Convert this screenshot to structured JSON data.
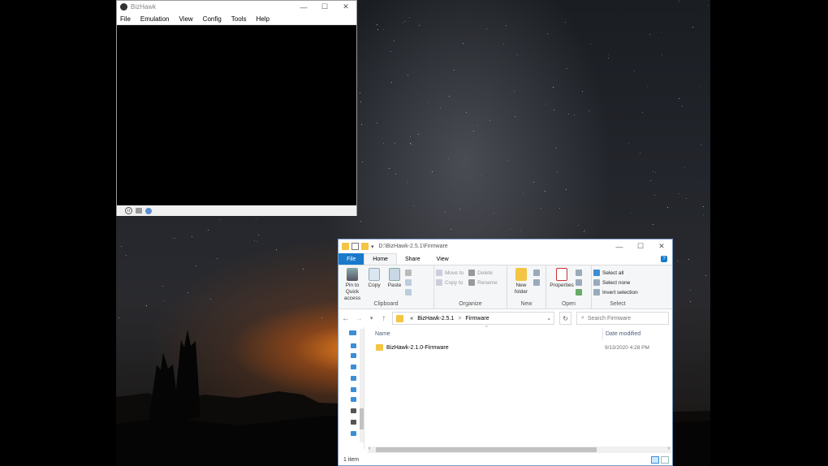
{
  "bizhawk": {
    "title": "BizHawk",
    "menu": [
      "File",
      "Emulation",
      "View",
      "Config",
      "Tools",
      "Help"
    ],
    "caption": {
      "minimize": "—",
      "maximize": "☐",
      "close": "✕"
    }
  },
  "explorer": {
    "title_path": "D:\\BizHawk-2.5.1\\Firmware",
    "caption": {
      "minimize": "—",
      "maximize": "☐",
      "close": "✕"
    },
    "tabs": {
      "file": "File",
      "home": "Home",
      "share": "Share",
      "view": "View"
    },
    "ribbon": {
      "clipboard": {
        "pin": "Pin to Quick access",
        "copy": "Copy",
        "paste": "Paste",
        "label": "Clipboard"
      },
      "organize": {
        "move_to": "Move to",
        "copy_to": "Copy to",
        "delete": "Delete",
        "rename": "Rename",
        "label": "Organize"
      },
      "new": {
        "new_folder": "New folder",
        "label": "New"
      },
      "open": {
        "properties": "Properties",
        "label": "Open"
      },
      "select": {
        "select_all": "Select all",
        "select_none": "Select none",
        "invert": "Invert selection",
        "label": "Select"
      }
    },
    "address": {
      "root_glyph": "«",
      "crumbs": [
        "BizHawk-2.5.1",
        "Firmware"
      ],
      "separator": ">"
    },
    "search_placeholder": "Search Firmware",
    "columns": {
      "name": "Name",
      "date_modified": "Date modified"
    },
    "files": [
      {
        "name": "BizHawk-2.1.0-Firmware",
        "date": "9/13/2020 4:28 PM"
      }
    ],
    "status": "1 item"
  },
  "colors": {
    "accent": "#1979ca",
    "folder": "#f4c542"
  }
}
